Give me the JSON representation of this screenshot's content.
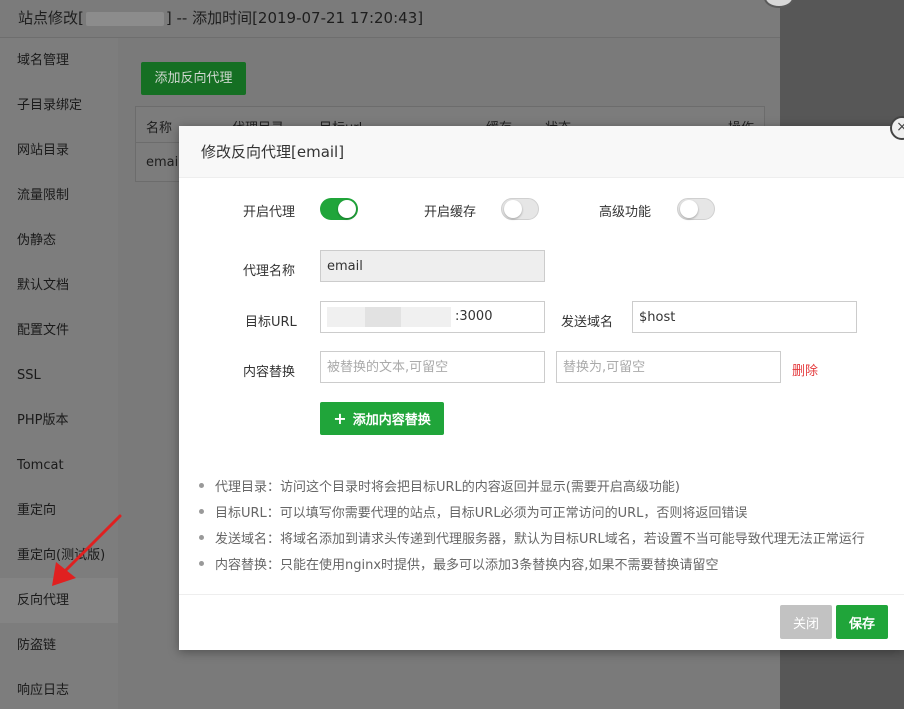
{
  "window": {
    "title_prefix": "站点修改[",
    "title_suffix": "] -- 添加时间[2019-07-21 17:20:43]"
  },
  "sidebar": {
    "items": [
      {
        "label": "域名管理"
      },
      {
        "label": "子目录绑定"
      },
      {
        "label": "网站目录"
      },
      {
        "label": "流量限制"
      },
      {
        "label": "伪静态"
      },
      {
        "label": "默认文档"
      },
      {
        "label": "配置文件"
      },
      {
        "label": "SSL"
      },
      {
        "label": "PHP版本"
      },
      {
        "label": "Tomcat"
      },
      {
        "label": "重定向"
      },
      {
        "label": "重定向(测试版)"
      },
      {
        "label": "反向代理"
      },
      {
        "label": "防盗链"
      },
      {
        "label": "响应日志"
      }
    ],
    "active_index": 12
  },
  "content": {
    "add_button": "添加反向代理",
    "table": {
      "headers": [
        "名称",
        "代理目录",
        "目标url",
        "缓存",
        "状态",
        "操作"
      ],
      "rows": [
        [
          "email"
        ]
      ]
    }
  },
  "modal": {
    "title": "修改反向代理[email]",
    "toggles": {
      "proxy_label": "开启代理",
      "cache_label": "开启缓存",
      "advanced_label": "高级功能",
      "proxy_on": true,
      "cache_on": false,
      "advanced_on": false
    },
    "fields": {
      "name_label": "代理名称",
      "name_value": "email",
      "target_label": "目标URL",
      "target_value_visible": ":3000",
      "send_domain_label": "发送域名",
      "send_domain_value": "$host",
      "replace_label": "内容替换",
      "replace_from_placeholder": "被替换的文本,可留空",
      "replace_to_placeholder": "替换为,可留空",
      "delete_label": "删除"
    },
    "add_replace_button": "添加内容替换",
    "tips": [
      "代理目录：访问这个目录时将会把目标URL的内容返回并显示(需要开启高级功能)",
      "目标URL：可以填写你需要代理的站点，目标URL必须为可正常访问的URL，否则将返回错误",
      "发送域名：将域名添加到请求头传递到代理服务器，默认为目标URL域名，若设置不当可能导致代理无法正常运行",
      "内容替换：只能在使用nginx时提供，最多可以添加3条替换内容,如果不需要替换请留空"
    ],
    "close_button": "关闭",
    "save_button": "保存",
    "close_icon_glyph": "×"
  },
  "colors": {
    "accent_green": "#20a53a",
    "delete_red": "#e4393c"
  }
}
